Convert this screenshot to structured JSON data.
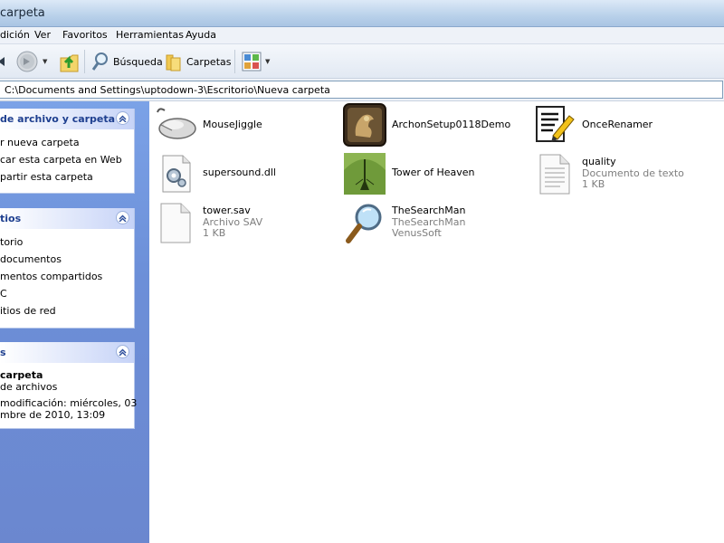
{
  "window": {
    "title": "carpeta"
  },
  "menu": [
    "dición",
    "Ver",
    "Favoritos",
    "Herramientas",
    "Ayuda"
  ],
  "toolbar": {
    "search_label": "Búsqueda",
    "folders_label": "Carpetas"
  },
  "address": {
    "value": "C:\\Documents and Settings\\uptodown-3\\Escritorio\\Nueva carpeta"
  },
  "panels": {
    "tasks": {
      "title": "de archivo y carpeta",
      "items": [
        "r nueva carpeta",
        "car esta carpeta en Web",
        "partir esta carpeta"
      ]
    },
    "places": {
      "title": "tios",
      "items": [
        "torio",
        "documentos",
        "mentos compartidos",
        "C",
        "itios de red"
      ]
    },
    "details": {
      "title": "s",
      "name": "carpeta",
      "type": "de archivos",
      "modified_line1": "modificación: miércoles, 03",
      "modified_line2": "mbre de 2010, 13:09"
    }
  },
  "files": [
    {
      "name": "MouseJiggle",
      "icon": "mouse-icon"
    },
    {
      "name": "ArchonSetup0118Demo",
      "icon": "archon-icon"
    },
    {
      "name": "OnceRenamer",
      "icon": "renamer-icon"
    },
    {
      "name": "supersound.dll",
      "icon": "dll-icon"
    },
    {
      "name": "Tower of Heaven",
      "icon": "tower-icon"
    },
    {
      "name": "quality",
      "icon": "text-file-icon",
      "type": "Documento de texto",
      "size": "1 KB"
    },
    {
      "name": "tower.sav",
      "icon": "blank-file-icon",
      "type": "Archivo SAV",
      "size": "1 KB"
    },
    {
      "name": "TheSearchMan",
      "icon": "magnifier-icon",
      "type": "TheSearchMan",
      "size": "VenusSoft"
    }
  ]
}
